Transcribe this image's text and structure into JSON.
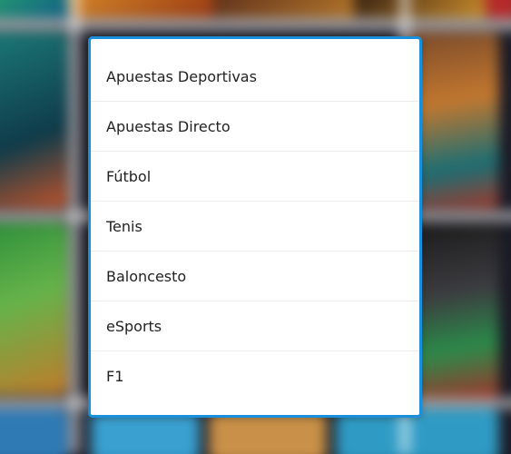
{
  "menu": {
    "items": [
      {
        "label": "Apuestas Deportivas"
      },
      {
        "label": "Apuestas Directo"
      },
      {
        "label": "Fútbol"
      },
      {
        "label": "Tenis"
      },
      {
        "label": "Baloncesto"
      },
      {
        "label": "eSports"
      },
      {
        "label": "F1"
      }
    ]
  },
  "colors": {
    "menu_border": "#1a8fdc",
    "menu_background": "#ffffff",
    "item_text": "#222222"
  }
}
